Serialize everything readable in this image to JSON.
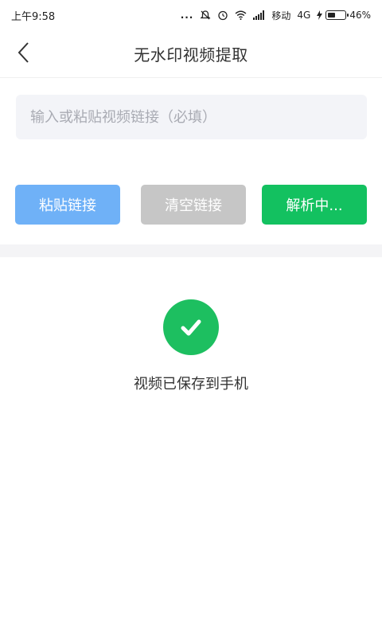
{
  "status_bar": {
    "time": "上午9:58",
    "dots": "...",
    "carrier": "移动",
    "network": "4G",
    "battery": "46%",
    "battery_level": 0.46,
    "icons": [
      "mute-icon",
      "alarm-icon",
      "wifi-icon",
      "signal-icon",
      "charging-icon",
      "battery-icon"
    ]
  },
  "header": {
    "title": "无水印视频提取",
    "back_icon": "chevron-left-icon"
  },
  "input": {
    "placeholder": "输入或粘贴视频链接（必填）",
    "value": ""
  },
  "buttons": {
    "paste_label": "粘贴链接",
    "clear_label": "清空链接",
    "parse_label": "解析中..."
  },
  "result": {
    "icon": "check-circle-icon",
    "message": "视频已保存到手机"
  },
  "colors": {
    "paste_button": "#6fb1f7",
    "clear_button": "#c6c6c6",
    "parse_button": "#13c160",
    "success": "#1dbf60",
    "input_bg": "#f3f4f8"
  }
}
